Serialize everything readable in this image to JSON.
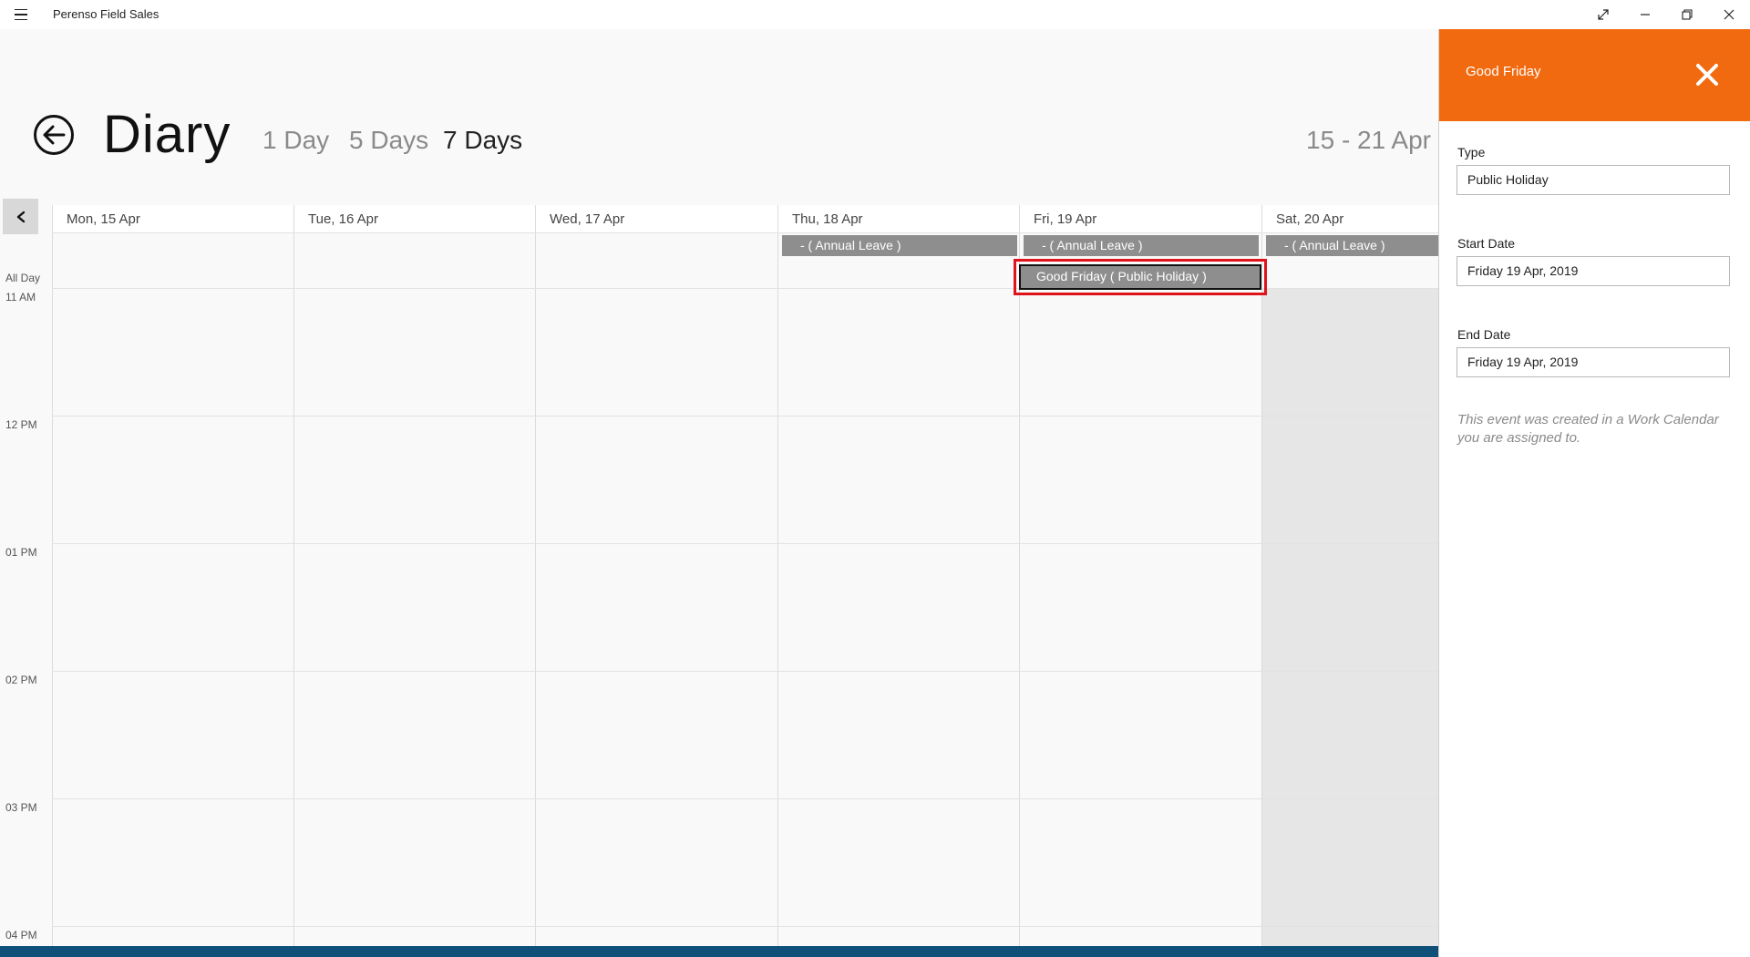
{
  "app": {
    "title": "Perenso Field Sales"
  },
  "window": {
    "fullscreen_icon": "expand-icon",
    "minimize_icon": "minimize-icon",
    "restore_icon": "restore-icon",
    "close_icon": "close-icon"
  },
  "header": {
    "title": "Diary",
    "tabs": [
      {
        "label": "1 Day",
        "active": false
      },
      {
        "label": "5 Days",
        "active": false
      },
      {
        "label": "7 Days",
        "active": true
      }
    ],
    "date_range": "15 - 21 Apr"
  },
  "calendar": {
    "days": [
      "Mon, 15 Apr",
      "Tue, 16 Apr",
      "Wed, 17 Apr",
      "Thu, 18 Apr",
      "Fri, 19 Apr",
      "Sat, 20 Apr"
    ],
    "all_day_label": "All Day",
    "times": [
      "11 AM",
      "12 PM",
      "01 PM",
      "02 PM",
      "03 PM",
      "04 PM"
    ],
    "events": [
      {
        "day": "Thu, 18 Apr",
        "label": "-  ( Annual Leave )"
      },
      {
        "day": "Fri, 19 Apr",
        "label": "-  ( Annual Leave )"
      },
      {
        "day": "Sat, 20 Apr",
        "label": "-  ( Annual Leave )"
      },
      {
        "day": "Fri, 19 Apr",
        "label": "Good Friday  ( Public Holiday )",
        "selected": true
      }
    ]
  },
  "panel": {
    "title": "Good Friday",
    "fields": [
      {
        "label": "Type",
        "value": "Public Holiday"
      },
      {
        "label": "Start Date",
        "value": "Friday 19 Apr, 2019"
      },
      {
        "label": "End Date",
        "value": "Friday 19 Apr, 2019"
      }
    ],
    "note": "This event was created in a Work Calendar you are assigned to."
  },
  "colors": {
    "accent": "#f26a10",
    "event": "#8e8e8e",
    "selection": "#e0121c",
    "footer": "#0f5078"
  }
}
